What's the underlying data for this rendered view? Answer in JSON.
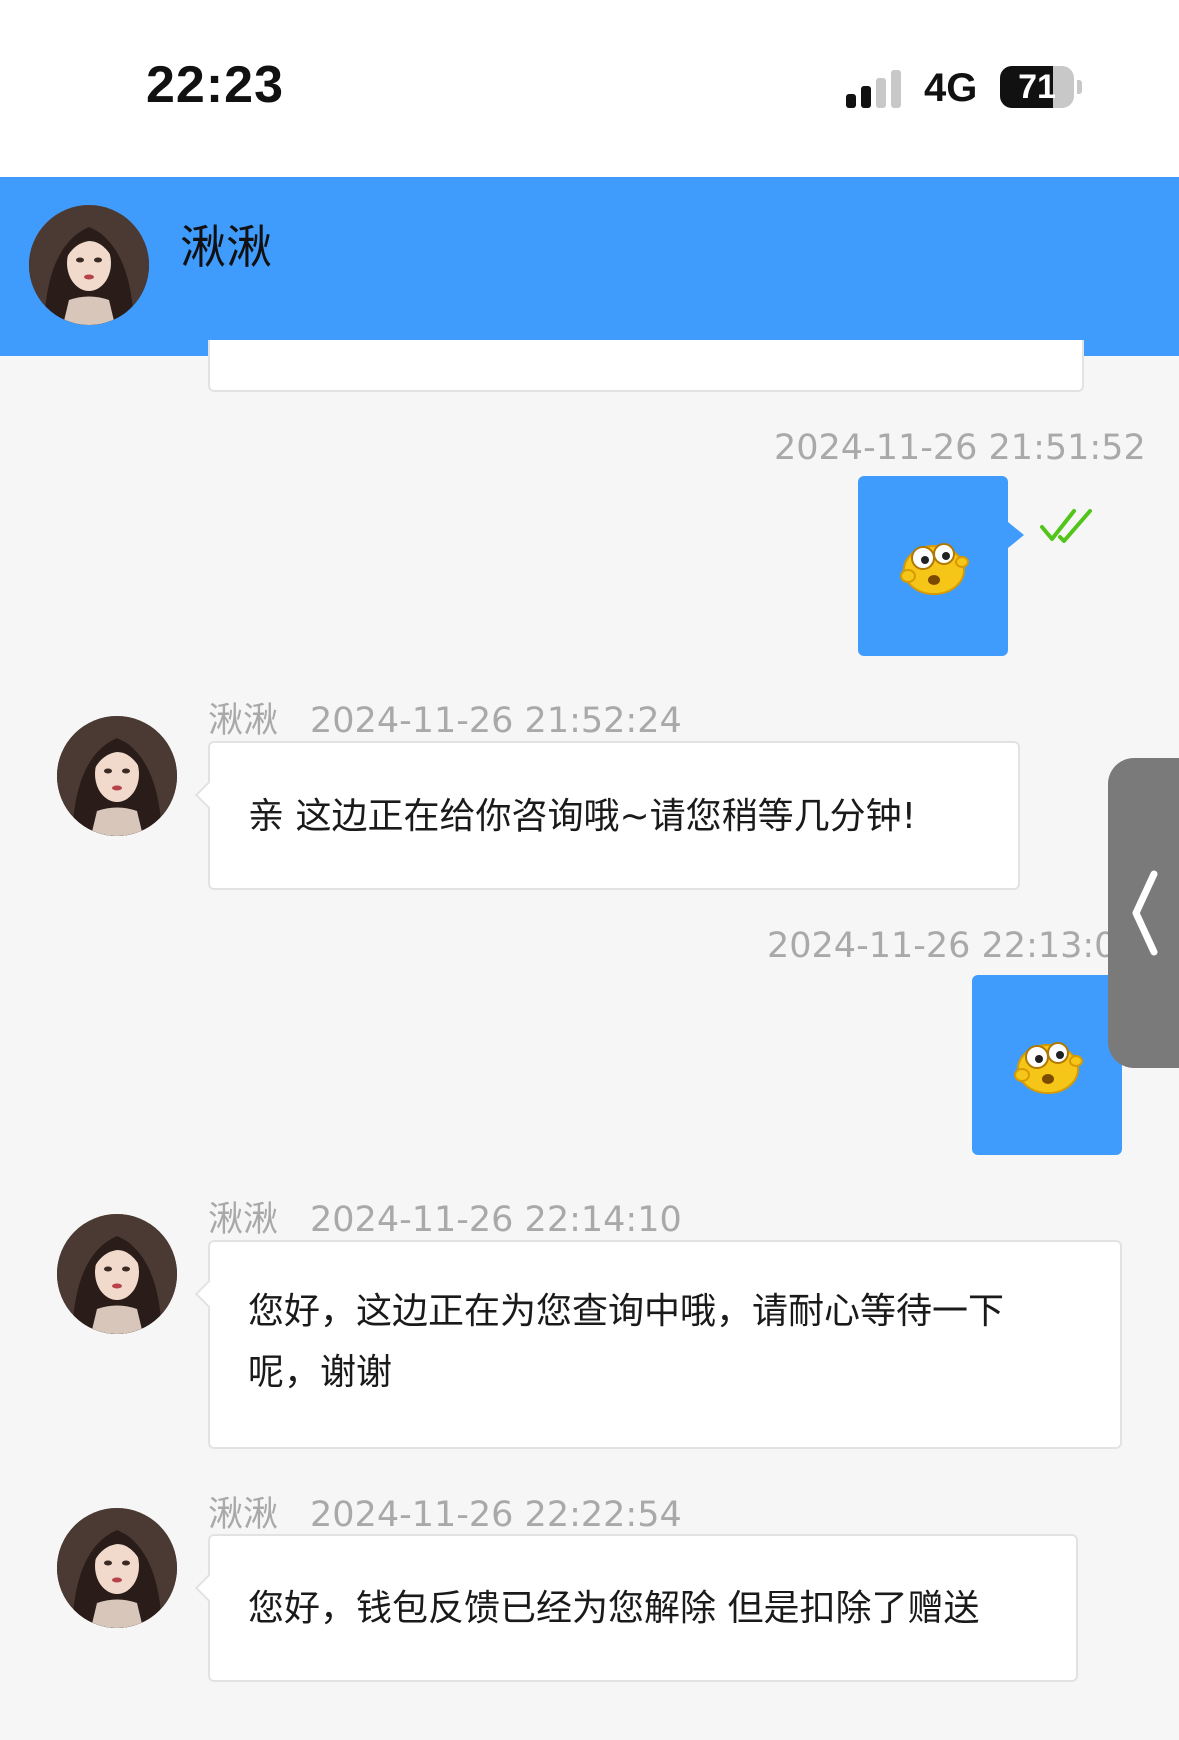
{
  "status_bar": {
    "time": "22:23",
    "network": "4G",
    "battery": "71",
    "battery_level_percent": 71,
    "signal_bars_active": 2,
    "signal_bars_total": 4
  },
  "header": {
    "contact_name": "湫湫",
    "background_color": "#409cfc"
  },
  "messages": [
    {
      "type": "sent",
      "timestamp": "2024-11-26 21:51:52",
      "content": "emoji-surprised",
      "read": true
    },
    {
      "type": "received",
      "sender": "湫湫",
      "timestamp": "2024-11-26 21:52:24",
      "lines": [
        "亲 这边正在给你咨询哦~请您稍等几分钟!"
      ]
    },
    {
      "type": "sent",
      "timestamp": "2024-11-26 22:13:06",
      "content": "emoji-surprised"
    },
    {
      "type": "received",
      "sender": "湫湫",
      "timestamp": "2024-11-26 22:14:10",
      "lines": [
        "您好，这边正在为您查询中哦，请耐心等待一下",
        "呢，谢谢"
      ]
    },
    {
      "type": "received",
      "sender": "湫湫",
      "timestamp": "2024-11-26 22:22:54",
      "lines": [
        "您好，钱包反馈已经为您解除 但是扣除了赠送"
      ]
    }
  ],
  "icons": {
    "read_check": "double-check-icon",
    "side_panel": "chevron-left-icon",
    "emoji": "surprised-face-emoji"
  },
  "colors": {
    "accent": "#409cfc",
    "check": "#52c41a",
    "meta_text": "#a9a9a9"
  }
}
